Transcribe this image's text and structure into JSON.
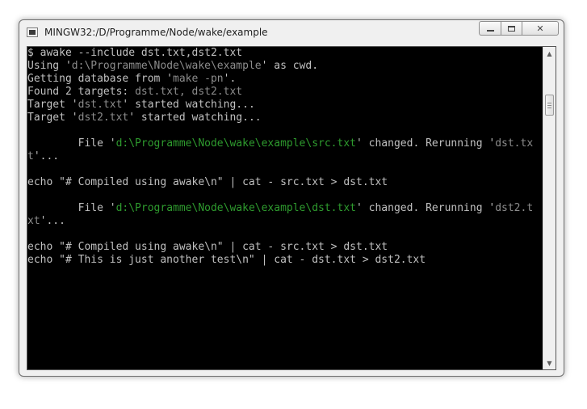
{
  "window": {
    "title": "MINGW32:/D/Programme/Node/wake/example"
  },
  "caption_buttons": {
    "minimize_icon": "minimize-icon",
    "maximize_icon": "restore-icon",
    "close_icon": "close-icon",
    "close_glyph": "✕"
  },
  "scrollbar": {
    "up_glyph": "▲",
    "down_glyph": "▼"
  },
  "colors": {
    "console_bg": "#000000",
    "console_text": "#c0c0c0",
    "highlight_gray": "#8c8c8c",
    "path_green": "#2e9b2e"
  },
  "console": {
    "lines": [
      {
        "segments": [
          {
            "t": "$ awake --include dst.txt,dst2.txt"
          }
        ]
      },
      {
        "segments": [
          {
            "t": "Using '"
          },
          {
            "t": "d:\\Programme\\Node\\wake\\example",
            "c": "gray"
          },
          {
            "t": "' as cwd."
          }
        ]
      },
      {
        "segments": [
          {
            "t": "Getting database from '"
          },
          {
            "t": "make -pn",
            "c": "gray"
          },
          {
            "t": "'."
          }
        ]
      },
      {
        "segments": [
          {
            "t": "Found 2 targets: "
          },
          {
            "t": "dst.txt, dst2.txt",
            "c": "gray"
          }
        ]
      },
      {
        "segments": [
          {
            "t": "Target '"
          },
          {
            "t": "dst.txt",
            "c": "gray"
          },
          {
            "t": "' started watching..."
          }
        ]
      },
      {
        "segments": [
          {
            "t": "Target '"
          },
          {
            "t": "dst2.txt",
            "c": "gray"
          },
          {
            "t": "' started watching..."
          }
        ]
      },
      {
        "segments": [
          {
            "t": ""
          }
        ]
      },
      {
        "segments": [
          {
            "t": "        File '"
          },
          {
            "t": "d:\\Programme\\Node\\wake\\example\\src.txt",
            "c": "green"
          },
          {
            "t": "' changed. Rerunning '"
          },
          {
            "t": "dst.tx",
            "c": "gray"
          }
        ]
      },
      {
        "segments": [
          {
            "t": "t",
            "c": "gray"
          },
          {
            "t": "'..."
          }
        ]
      },
      {
        "segments": [
          {
            "t": ""
          }
        ]
      },
      {
        "segments": [
          {
            "t": "echo \"# Compiled using awake\\n\" | cat - src.txt > dst.txt"
          }
        ]
      },
      {
        "segments": [
          {
            "t": ""
          }
        ]
      },
      {
        "segments": [
          {
            "t": "        File '"
          },
          {
            "t": "d:\\Programme\\Node\\wake\\example\\dst.txt",
            "c": "green"
          },
          {
            "t": "' changed. Rerunning '"
          },
          {
            "t": "dst2.t",
            "c": "gray"
          }
        ]
      },
      {
        "segments": [
          {
            "t": "xt",
            "c": "gray"
          },
          {
            "t": "'..."
          }
        ]
      },
      {
        "segments": [
          {
            "t": ""
          }
        ]
      },
      {
        "segments": [
          {
            "t": "echo \"# Compiled using awake\\n\" | cat - src.txt > dst.txt"
          }
        ]
      },
      {
        "segments": [
          {
            "t": "echo \"# This is just another test\\n\" | cat - dst.txt > dst2.txt"
          }
        ]
      }
    ]
  }
}
